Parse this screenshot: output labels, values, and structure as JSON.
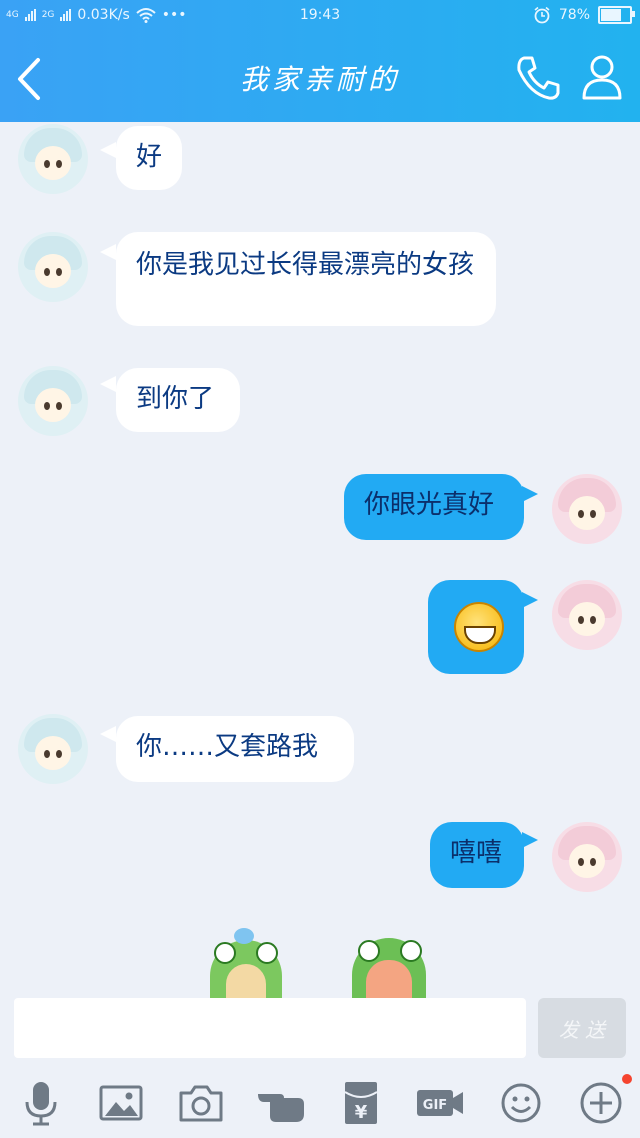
{
  "status_bar": {
    "network_left": "4G",
    "network_right": "2G",
    "speed": "0.03K/s",
    "more": "•••",
    "time": "19:43",
    "battery": "78%",
    "battery_level": 0.78
  },
  "header": {
    "title": "我家亲耐的",
    "back_icon": "chevron-left-icon",
    "call_icon": "phone-icon",
    "profile_icon": "person-icon"
  },
  "messages": [
    {
      "side": "left",
      "text": "好"
    },
    {
      "side": "left",
      "text": "你是我见过长得最漂亮的女孩"
    },
    {
      "side": "left",
      "text": "到你了"
    },
    {
      "side": "right",
      "text": "你眼光真好"
    },
    {
      "side": "right",
      "emoji": "grinning-face-emoji"
    },
    {
      "side": "left",
      "text": "你……又套路我"
    },
    {
      "side": "right",
      "text": "嘻嘻"
    }
  ],
  "composer": {
    "placeholder": "",
    "send_label": "发 送"
  },
  "toolbar": {
    "icons": [
      "microphone-icon",
      "image-icon",
      "camera-icon",
      "poke-hand-icon",
      "red-packet-icon",
      "gif-icon",
      "emoji-icon",
      "plus-icon"
    ],
    "gif_label": "GIF",
    "red_packet_label": "¥"
  },
  "colors": {
    "header_gradient_start": "#3aa2f5",
    "header_gradient_end": "#22b2ef",
    "chat_background": "#edf1f8",
    "outgoing_bubble": "#22aaf3",
    "incoming_bubble": "#ffffff",
    "message_text": "#0b3a82",
    "notification_dot": "#f5442f"
  }
}
